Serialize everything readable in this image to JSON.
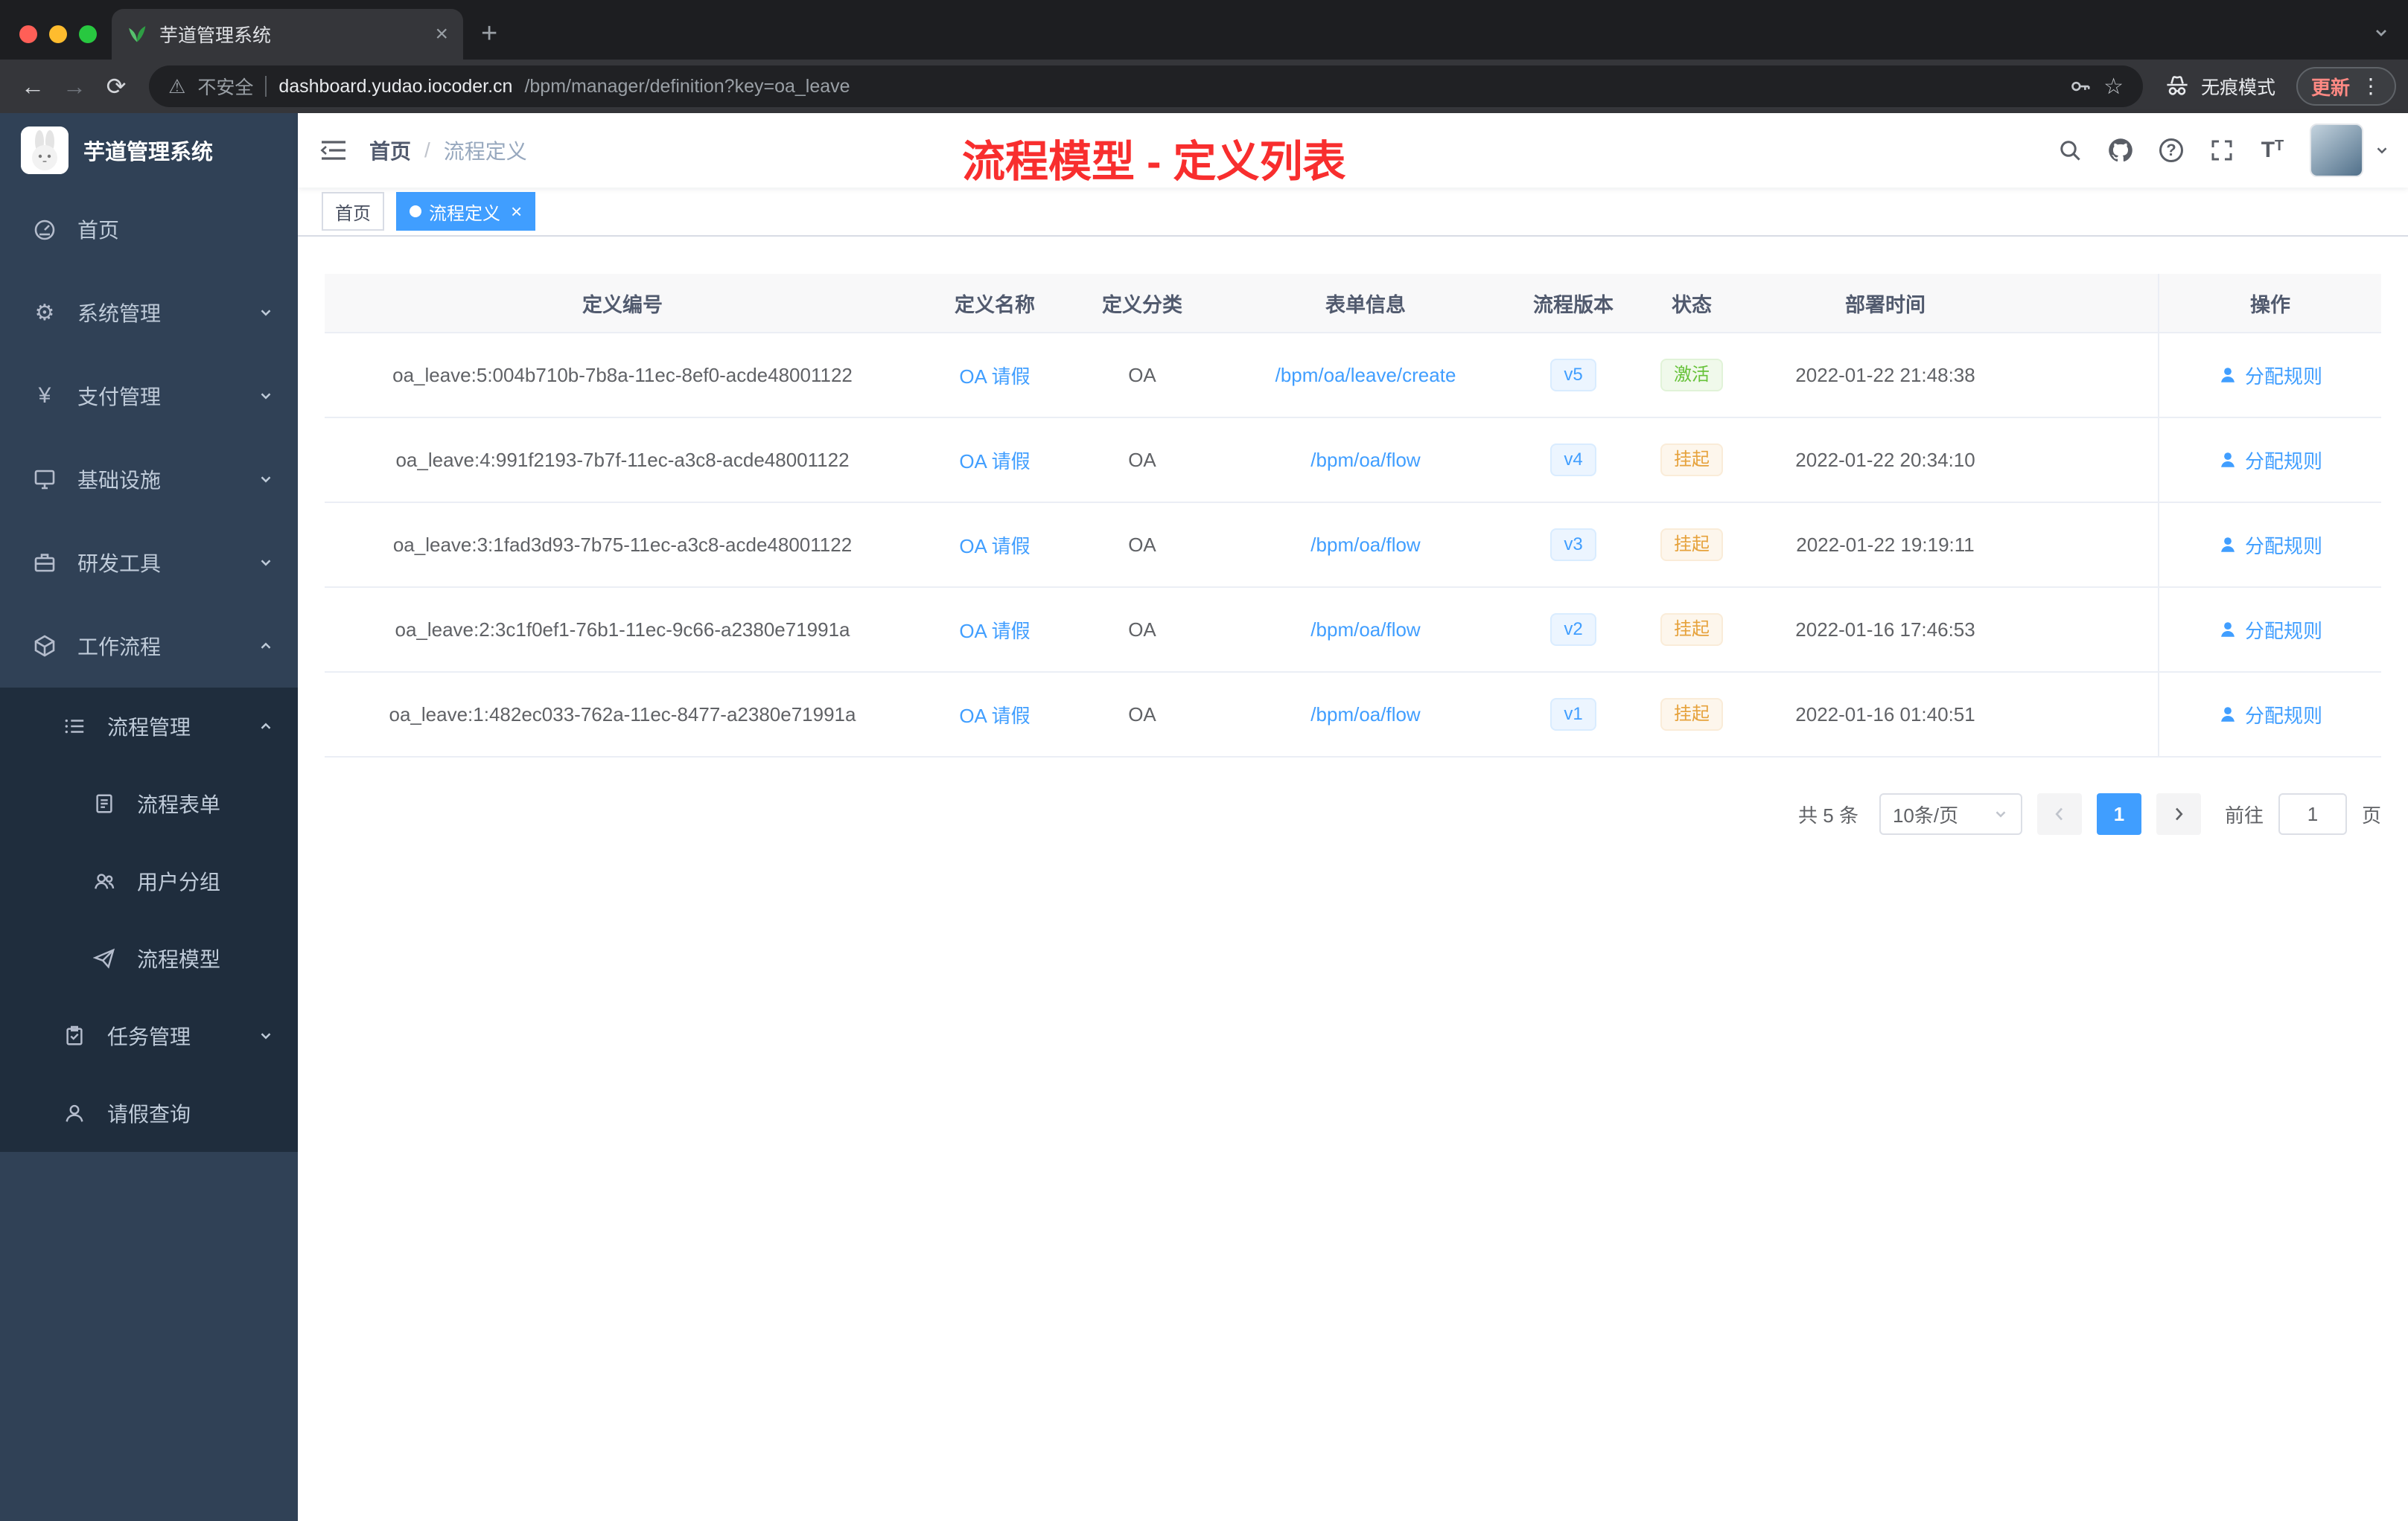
{
  "icons": {
    "close": "×",
    "plus": "+",
    "back": "←",
    "forward": "→",
    "reload": "⟳",
    "more": "⋮",
    "star": "☆",
    "warning": "⚠",
    "help": "?",
    "gear": "⚙",
    "yen": "¥",
    "font_letter": "T"
  },
  "browser": {
    "tab_title": "芋道管理系统",
    "security_label": "不安全",
    "url_host": "dashboard.yudao.iocoder.cn",
    "url_path": "/bpm/manager/definition?key=oa_leave",
    "incognito_label": "无痕模式",
    "update_label": "更新"
  },
  "sidebar": {
    "logo_title": "芋道管理系统",
    "items": [
      {
        "label": "首页"
      },
      {
        "label": "系统管理"
      },
      {
        "label": "支付管理"
      },
      {
        "label": "基础设施"
      },
      {
        "label": "研发工具"
      },
      {
        "label": "工作流程"
      },
      {
        "label": "流程管理"
      },
      {
        "label": "流程表单"
      },
      {
        "label": "用户分组"
      },
      {
        "label": "流程模型"
      },
      {
        "label": "任务管理"
      },
      {
        "label": "请假查询"
      }
    ]
  },
  "header": {
    "breadcrumb_home": "首页",
    "breadcrumb_separator": "/",
    "breadcrumb_current": "流程定义",
    "annotation": "流程模型 - 定义列表"
  },
  "tags": [
    {
      "label": "首页"
    },
    {
      "label": "流程定义"
    }
  ],
  "table": {
    "columns": [
      "定义编号",
      "定义名称",
      "定义分类",
      "表单信息",
      "流程版本",
      "状态",
      "部署时间",
      "操作"
    ],
    "rows": [
      {
        "id": "oa_leave:5:004b710b-7b8a-11ec-8ef0-acde48001122",
        "name": "OA 请假",
        "category": "OA",
        "form": "/bpm/oa/leave/create",
        "version": "v5",
        "status": "激活",
        "time": "2022-01-22 21:48:38",
        "action": "分配规则"
      },
      {
        "id": "oa_leave:4:991f2193-7b7f-11ec-a3c8-acde48001122",
        "name": "OA 请假",
        "category": "OA",
        "form": "/bpm/oa/flow",
        "version": "v4",
        "status": "挂起",
        "time": "2022-01-22 20:34:10",
        "action": "分配规则"
      },
      {
        "id": "oa_leave:3:1fad3d93-7b75-11ec-a3c8-acde48001122",
        "name": "OA 请假",
        "category": "OA",
        "form": "/bpm/oa/flow",
        "version": "v3",
        "status": "挂起",
        "time": "2022-01-22 19:19:11",
        "action": "分配规则"
      },
      {
        "id": "oa_leave:2:3c1f0ef1-76b1-11ec-9c66-a2380e71991a",
        "name": "OA 请假",
        "category": "OA",
        "form": "/bpm/oa/flow",
        "version": "v2",
        "status": "挂起",
        "time": "2022-01-16 17:46:53",
        "action": "分配规则"
      },
      {
        "id": "oa_leave:1:482ec033-762a-11ec-8477-a2380e71991a",
        "name": "OA 请假",
        "category": "OA",
        "form": "/bpm/oa/flow",
        "version": "v1",
        "status": "挂起",
        "time": "2022-01-16 01:40:51",
        "action": "分配规则"
      }
    ]
  },
  "pagination": {
    "total_label": "共 5 条",
    "page_size": "10条/页",
    "current_page": "1",
    "goto_label": "前往",
    "goto_value": "1",
    "page_unit": "页"
  },
  "colors": {
    "accent": "#409eff",
    "success": "#67c23a",
    "warning": "#e6a23c",
    "annotation_red": "#f82e2e",
    "sidebar_bg": "#304156",
    "submenu_bg": "#1f2d3d"
  }
}
